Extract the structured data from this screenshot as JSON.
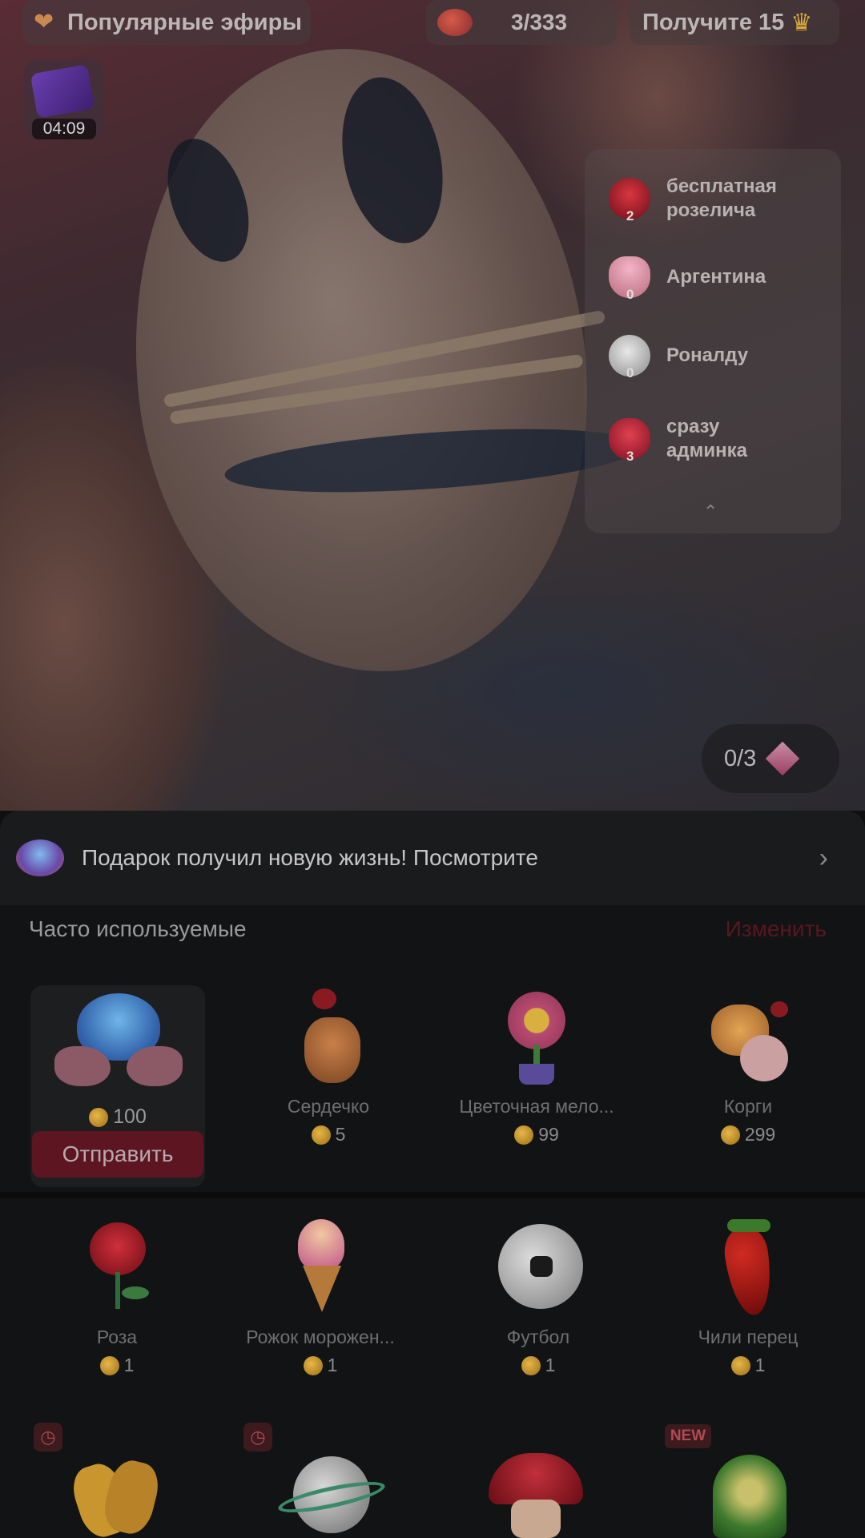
{
  "top_bar": {
    "popular_label": "Популярные эфиры",
    "progress_count": "3/333",
    "get_label": "Получите 15"
  },
  "timer_gift": {
    "time": "04:09"
  },
  "ranking": {
    "items": [
      {
        "label": "бесплатная розелича",
        "count": "2",
        "icon": "rose-icon"
      },
      {
        "label": "Аргентина",
        "count": "0",
        "icon": "ice-cream-icon"
      },
      {
        "label": "Роналду",
        "count": "0",
        "icon": "football-icon"
      },
      {
        "label": "сразу админка",
        "count": "3",
        "icon": "heart-icon"
      }
    ]
  },
  "progress_pill": {
    "value": "0/3"
  },
  "banner": {
    "text": "Подарок получил новую жизнь! Посмотрите"
  },
  "section": {
    "title": "Часто используемые",
    "edit": "Изменить"
  },
  "selected_gift": {
    "price": "100",
    "send_label": "Отправить",
    "icon": "heart-hands-icon"
  },
  "gifts_row1": [
    {
      "name": "Сердечко",
      "price": "5",
      "icon": "finger-heart-icon"
    },
    {
      "name": "Цветочная мело...",
      "price": "99",
      "icon": "flower-icon"
    },
    {
      "name": "Корги",
      "price": "299",
      "icon": "corgi-icon"
    }
  ],
  "gifts_row2": [
    {
      "name": "Роза",
      "price": "1",
      "icon": "rose-icon"
    },
    {
      "name": "Рожок морожен...",
      "price": "1",
      "icon": "ice-cream-icon"
    },
    {
      "name": "Футбол",
      "price": "1",
      "icon": "football-icon"
    },
    {
      "name": "Чили перец",
      "price": "1",
      "icon": "chili-icon"
    }
  ],
  "gifts_row3": {
    "new_badge": "NEW",
    "icons": [
      "clapping-hands-icon",
      "planet-ball-icon",
      "mushroom-icon",
      "green-portal-icon"
    ]
  },
  "colors": {
    "accent_red": "#5c1521",
    "coin_gold": "#e8b64a",
    "sheet_bg": "#121314"
  }
}
